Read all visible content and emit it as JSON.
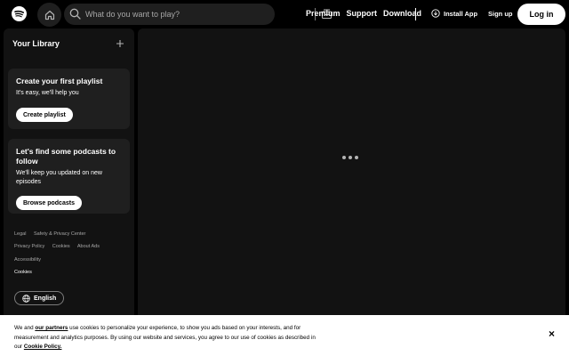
{
  "topbar": {
    "search_placeholder": "What do you want to play?",
    "nav": [
      "Premium",
      "Support",
      "Download"
    ],
    "install_label": "Install App",
    "signup_label": "Sign up",
    "login_label": "Log in"
  },
  "sidebar": {
    "title": "Your Library",
    "cards": [
      {
        "title": "Create your first playlist",
        "desc": "It's easy, we'll help you",
        "button": "Create playlist"
      },
      {
        "title": "Let's find some podcasts to follow",
        "desc": "We'll keep you updated on new episodes",
        "button": "Browse podcasts"
      }
    ],
    "footer_row1": [
      "Legal",
      "Safety & Privacy Center"
    ],
    "footer_row2": [
      "Privacy Policy",
      "Cookies",
      "About Ads"
    ],
    "footer_row3": [
      "Accessibility"
    ],
    "footer_row4": [
      "Cookies"
    ],
    "language_label": "English"
  },
  "cookie": {
    "prefix": "We and ",
    "partners_link": "our partners",
    "body": " use cookies to personalize your experience, to show you ads based on your interests, and for measurement and analytics purposes. By using our website and services, you agree to our use of cookies as described in our ",
    "policy_link": "Cookie Policy.",
    "close_label": "×"
  },
  "colors": {
    "background": "#000000",
    "panel": "#121212",
    "card": "#1f1f1f",
    "muted_text": "#a7a7a7"
  }
}
